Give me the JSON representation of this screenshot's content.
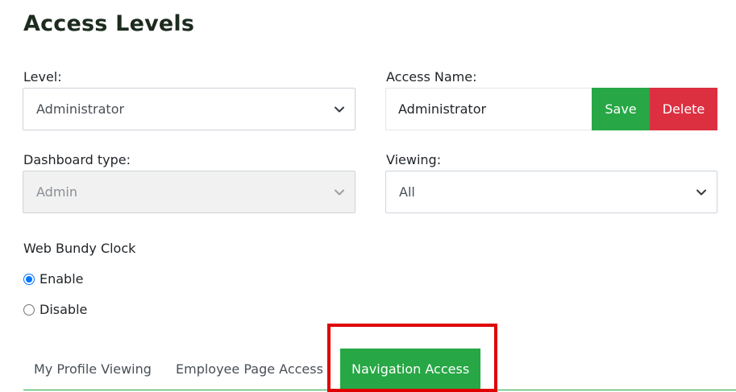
{
  "page": {
    "title": "Access Levels"
  },
  "form": {
    "level": {
      "label": "Level:",
      "value": "Administrator"
    },
    "access_name": {
      "label": "Access Name:",
      "value": "Administrator"
    },
    "save_label": "Save",
    "delete_label": "Delete",
    "dashboard_type": {
      "label": "Dashboard type:",
      "value": "Admin",
      "disabled": true
    },
    "viewing": {
      "label": "Viewing:",
      "value": "All"
    },
    "web_bundy_clock": {
      "label": "Web Bundy Clock",
      "options": [
        {
          "label": "Enable",
          "checked": true
        },
        {
          "label": "Disable",
          "checked": false
        }
      ]
    }
  },
  "tabs": [
    {
      "label": "My Profile Viewing",
      "active": false
    },
    {
      "label": "Employee Page Access",
      "active": false
    },
    {
      "label": "Navigation Access",
      "active": true
    }
  ],
  "colors": {
    "accent_green": "#27a745",
    "danger_red": "#dc3041",
    "highlight_red": "#e00000"
  },
  "icons": {
    "dropdown": "chevron-down-icon"
  }
}
